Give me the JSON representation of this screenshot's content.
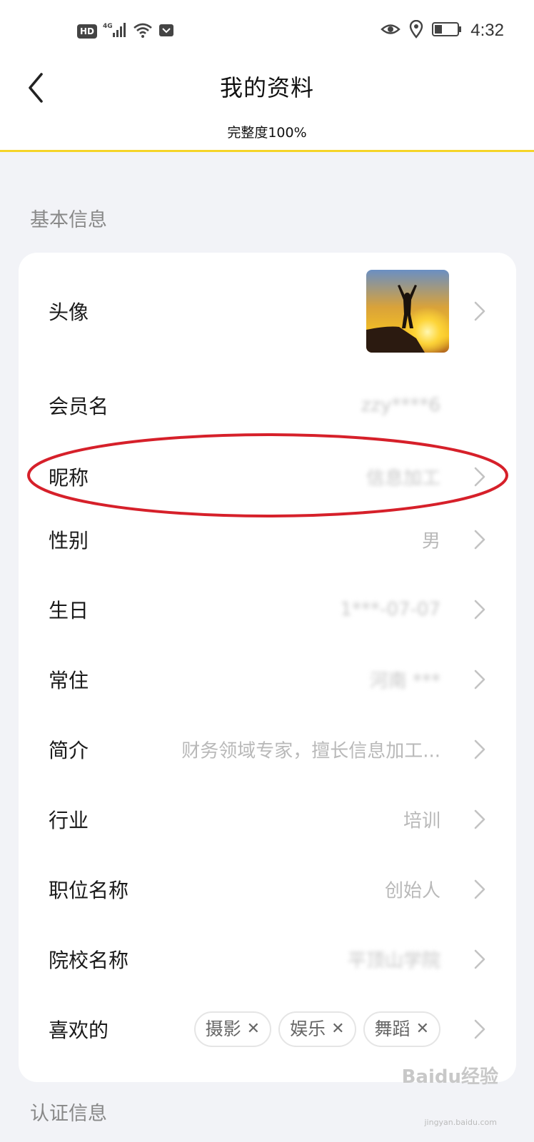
{
  "statusbar": {
    "hd": "HD",
    "network": "4G",
    "time": "4:32"
  },
  "header": {
    "title": "我的资料",
    "completeness": "完整度100%"
  },
  "sections": {
    "basic_title": "基本信息",
    "auth_title": "认证信息"
  },
  "rows": {
    "avatar": {
      "label": "头像"
    },
    "member": {
      "label": "会员名",
      "value": "zzy****6"
    },
    "nickname": {
      "label": "昵称",
      "value": "信息加工"
    },
    "gender": {
      "label": "性别",
      "value": "男"
    },
    "birthday": {
      "label": "生日",
      "value": "1***-07-07"
    },
    "residence": {
      "label": "常住",
      "value": "河南 ***"
    },
    "intro": {
      "label": "简介",
      "value": "财务领域专家，擅长信息加工..."
    },
    "industry": {
      "label": "行业",
      "value": "培训"
    },
    "position": {
      "label": "职位名称",
      "value": "创始人"
    },
    "school": {
      "label": "院校名称",
      "value": "平顶山学院"
    },
    "likes": {
      "label": "喜欢的",
      "tags": [
        "摄影",
        "娱乐",
        "舞蹈"
      ]
    }
  },
  "watermark": {
    "text": "Baidu经验",
    "sub": "jingyan.baidu.com"
  },
  "colors": {
    "accent": "#f5d428",
    "annotation": "#d6202a"
  }
}
